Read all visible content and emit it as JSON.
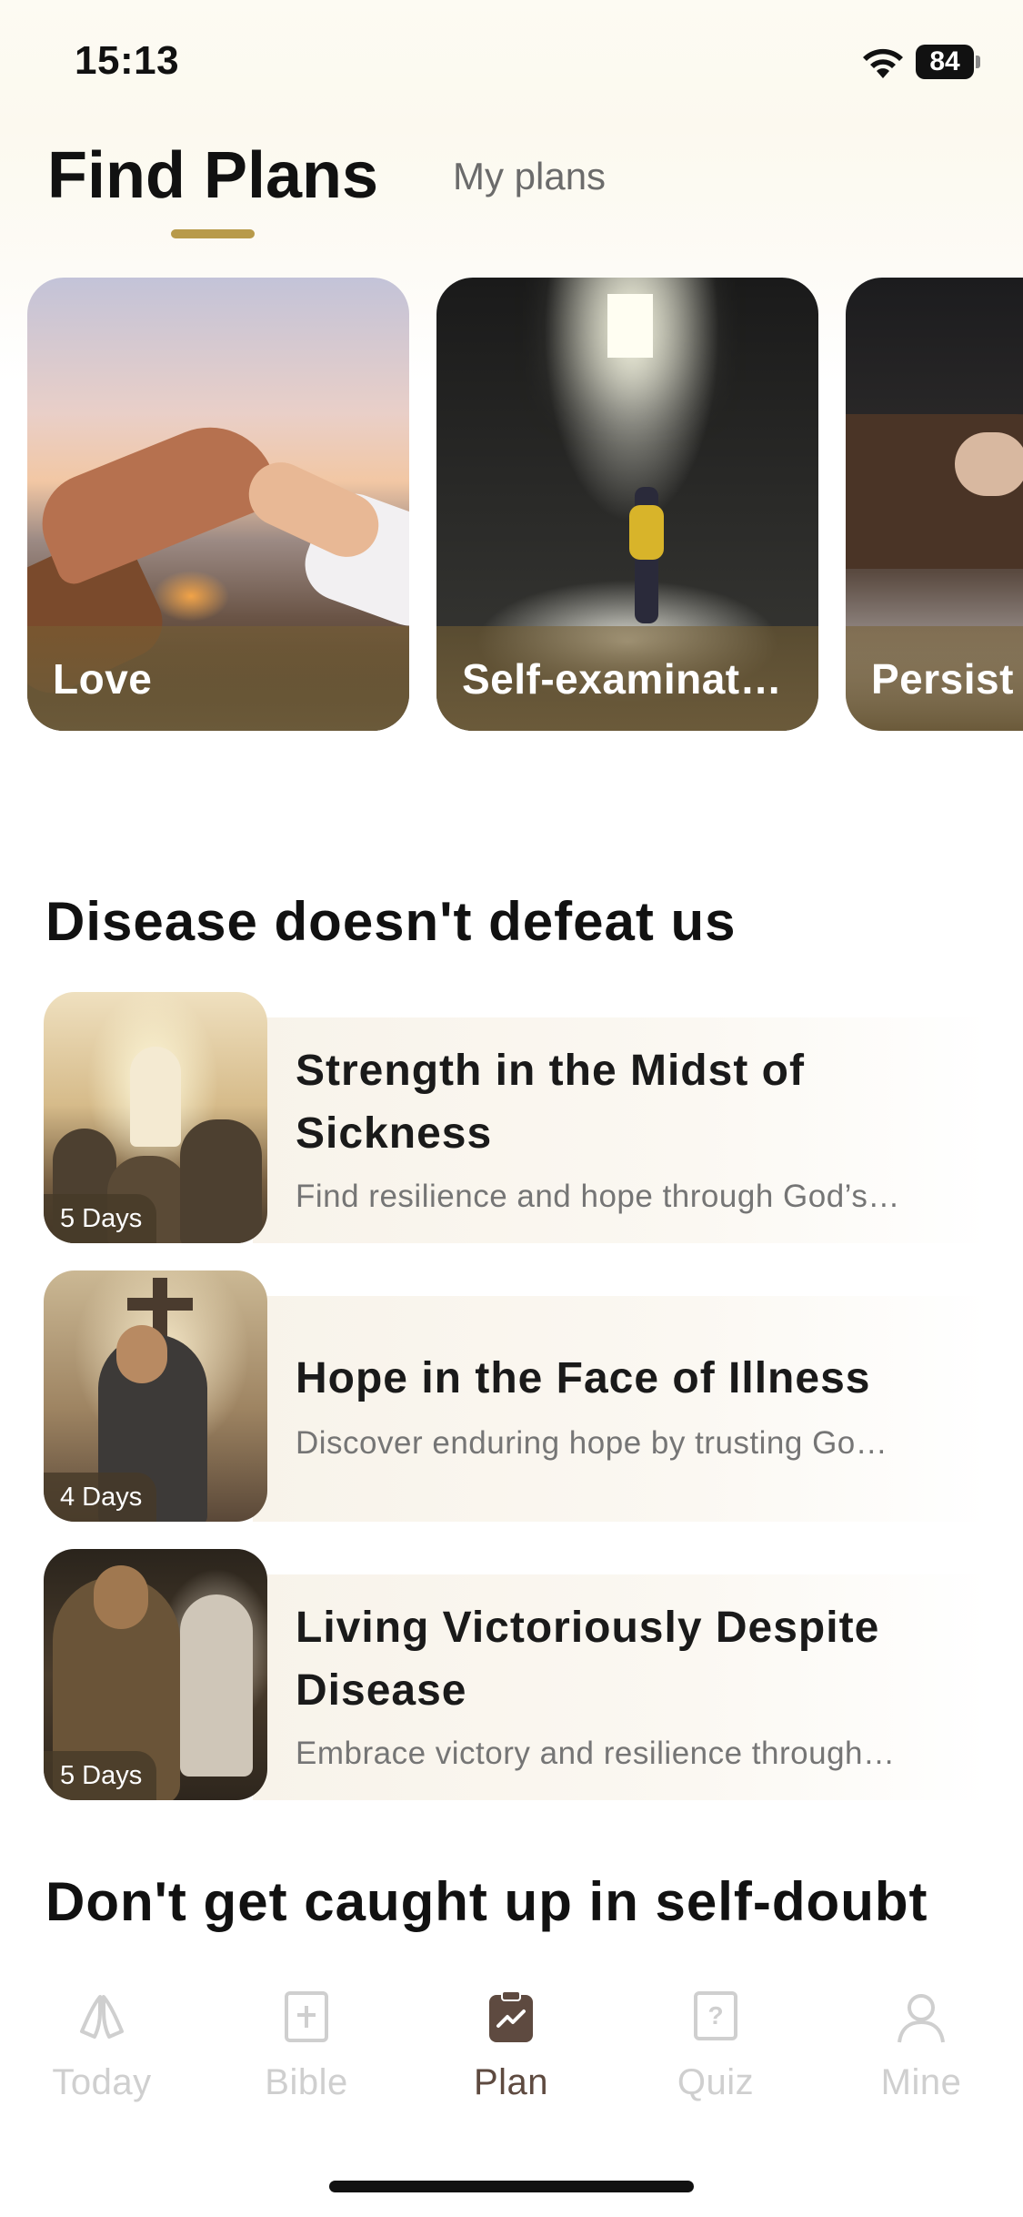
{
  "status_bar": {
    "time": "15:13",
    "battery": "84",
    "wifi_icon": "wifi-icon"
  },
  "header": {
    "tabs": [
      {
        "label": "Find Plans",
        "active": true
      },
      {
        "label": "My plans",
        "active": false
      }
    ],
    "accent_color": "#b89a4a"
  },
  "topics": [
    {
      "label": "Love"
    },
    {
      "label": "Self-examinat…"
    },
    {
      "label": "Persist"
    }
  ],
  "sections": [
    {
      "title": "Disease doesn't defeat us",
      "plans": [
        {
          "title": "Strength in the Midst of Sickness",
          "description": "Find resilience and hope through God’s…",
          "days": "5 Days"
        },
        {
          "title": "Hope in the Face of Illness",
          "description": "Discover enduring hope by trusting Go…",
          "days": "4 Days"
        },
        {
          "title": "Living Victoriously Despite Disease",
          "description": "Embrace victory and resilience through…",
          "days": "5 Days"
        }
      ]
    },
    {
      "title": "Don't get caught up in self-doubt",
      "plans": []
    }
  ],
  "tabbar": {
    "items": [
      {
        "label": "Today",
        "icon": "praying-hands-icon",
        "active": false
      },
      {
        "label": "Bible",
        "icon": "bible-icon",
        "active": false
      },
      {
        "label": "Plan",
        "icon": "plan-clipboard-icon",
        "active": true
      },
      {
        "label": "Quiz",
        "icon": "quiz-icon",
        "active": false
      },
      {
        "label": "Mine",
        "icon": "profile-icon",
        "active": false
      }
    ],
    "active_color": "#5e4a40",
    "inactive_color": "#cfcfcf"
  }
}
